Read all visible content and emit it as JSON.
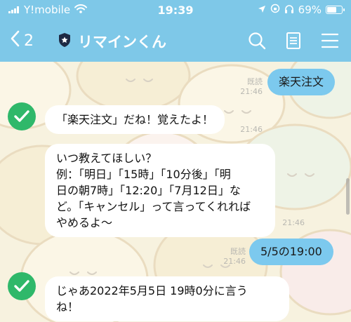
{
  "status_bar": {
    "carrier": "Y!mobile",
    "time": "19:39",
    "battery": "69%",
    "battery_level": 0.69
  },
  "header": {
    "back_count": "2",
    "title": "リマインくん"
  },
  "messages": [
    {
      "direction": "out",
      "text": "楽天注文",
      "read": "既読",
      "time": "21:46"
    },
    {
      "direction": "in",
      "text": "「楽天注文」だね！覚えたよ！",
      "time": "21:46"
    },
    {
      "direction": "in",
      "lines": [
        "いつ教えてほしい？",
        "例：「明日」「15時」「10分後」「明",
        "日の朝7時」「12:20」「7月12日」な",
        "ど。「キャンセル」って言ってくれれば",
        "やめるよ〜"
      ],
      "time": "21:46"
    },
    {
      "direction": "out",
      "text": "5/5の19:00",
      "read": "既読",
      "time": "21:46"
    },
    {
      "direction": "in",
      "lines": [
        "じゃあ2022年5月5日 19時0分に言う",
        "ね！"
      ],
      "time": ""
    }
  ],
  "colors": {
    "header": "#7ec8e8",
    "out_bubble": "#7cc9ee",
    "in_bubble": "#ffffff",
    "avatar": "#2fb86a"
  },
  "icons": {
    "back": "chevron-left-icon",
    "shield": "shield-icon",
    "search": "search-icon",
    "note": "note-icon",
    "menu": "menu-icon"
  }
}
